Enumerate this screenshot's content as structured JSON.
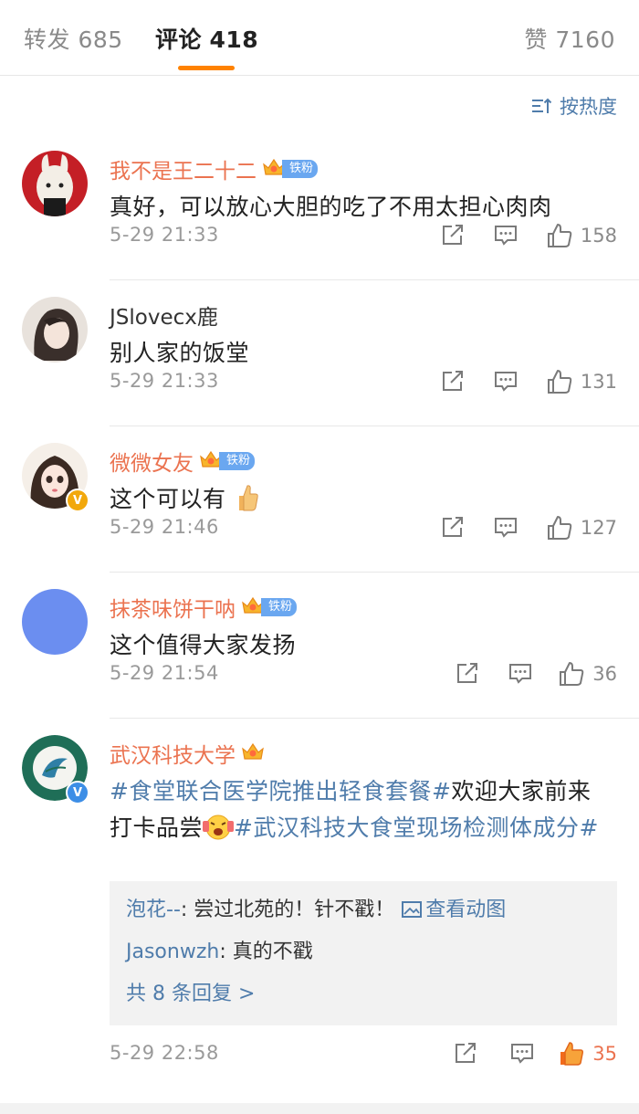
{
  "tabs": {
    "repost": {
      "label": "转发",
      "count": "685"
    },
    "comment": {
      "label": "评论",
      "count": "418"
    },
    "like": {
      "label": "赞",
      "count": "7160"
    }
  },
  "sort": {
    "label": "按热度",
    "icon": "sort-icon"
  },
  "comments": [
    {
      "user": "我不是王二十二",
      "badge": "铁粉",
      "text": "真好，可以放心大胆的吃了不用太担心肉肉",
      "time": "5-29 21:33",
      "likes": "158"
    },
    {
      "user": "JSlovecx鹿",
      "text": "别人家的饭堂",
      "time": "5-29 21:33",
      "likes": "131"
    },
    {
      "user": "微微女友",
      "badge": "铁粉",
      "text": "这个可以有",
      "emoji": "thumbs-up-emoji",
      "time": "5-29 21:46",
      "likes": "127"
    },
    {
      "user": "抹茶味饼干呐",
      "badge": "铁粉",
      "text": "这个值得大家发扬",
      "time": "5-29 21:54",
      "likes": "36"
    },
    {
      "user": "武汉科技大学",
      "text_parts": {
        "tag1": "#食堂联合医学院推出轻食套餐#",
        "mid": "欢迎大家前来打卡品尝",
        "tag2": "#武汉科技大食堂现场检测体成分#"
      },
      "replies": [
        {
          "user": "泡花--",
          "text": ": 尝过北苑的！针不戳！",
          "link": "查看动图"
        },
        {
          "user": "Jasonwzh",
          "text": ": 真的不戳"
        }
      ],
      "more_replies": "共 8 条回复 >",
      "time": "5-29 22:58",
      "likes": "35"
    }
  ],
  "colors": {
    "accent": "#ff8200",
    "username": "#eb7350",
    "link": "#4f7cab",
    "fan_badge": "#6aa7f0"
  }
}
